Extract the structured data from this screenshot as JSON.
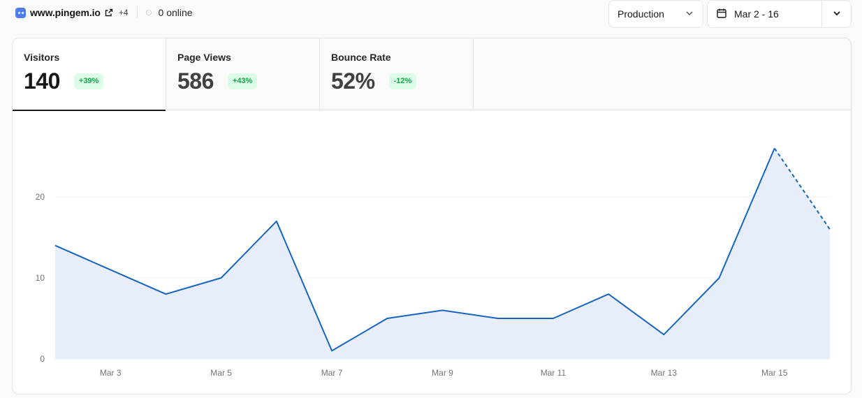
{
  "site": {
    "name": "www.pingem.io",
    "extra_count": "+4",
    "online": "0 online"
  },
  "controls": {
    "environment": "Production",
    "date_range": "Mar 2 - 16"
  },
  "stats": [
    {
      "label": "Visitors",
      "value": "140",
      "change": "+39%"
    },
    {
      "label": "Page Views",
      "value": "586",
      "change": "+43%"
    },
    {
      "label": "Bounce Rate",
      "value": "52%",
      "change": "-12%"
    }
  ],
  "colors": {
    "line": "#1565c0",
    "fill": "#e8eef9",
    "badge_bg": "#dcfce7",
    "badge_text": "#16a34a"
  },
  "chart_data": {
    "type": "area",
    "x": [
      "Mar 2",
      "Mar 3",
      "Mar 4",
      "Mar 5",
      "Mar 6",
      "Mar 7",
      "Mar 8",
      "Mar 9",
      "Mar 10",
      "Mar 11",
      "Mar 12",
      "Mar 13",
      "Mar 14",
      "Mar 15",
      "Mar 16"
    ],
    "x_tick_labels": [
      "Mar 3",
      "Mar 5",
      "Mar 7",
      "Mar 9",
      "Mar 11",
      "Mar 13",
      "Mar 15"
    ],
    "series": [
      {
        "values": [
          14,
          11,
          8,
          10,
          17,
          1,
          5,
          6,
          5,
          5,
          8,
          3,
          10,
          26,
          16
        ],
        "dashed_last_segment": true
      }
    ],
    "y_ticks": [
      0,
      10,
      20
    ],
    "ylim": [
      0,
      28
    ],
    "grid": true
  }
}
